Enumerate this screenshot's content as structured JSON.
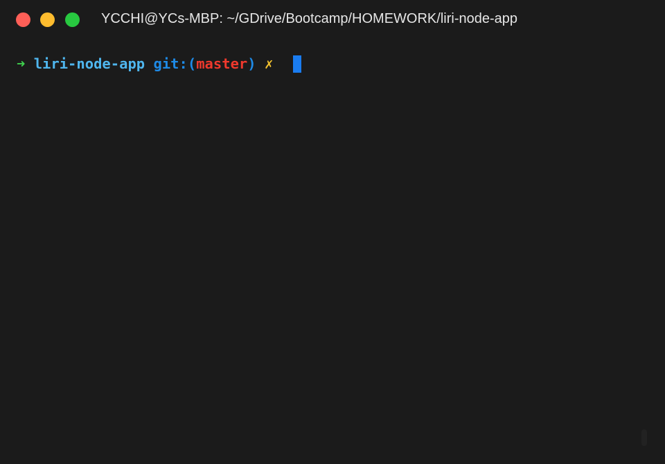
{
  "window": {
    "title": "YCCHI@YCs-MBP: ~/GDrive/Bootcamp/HOMEWORK/liri-node-app"
  },
  "prompt": {
    "arrow": "➜",
    "directory": "liri-node-app",
    "git_prefix": "git:(",
    "branch": "master",
    "git_suffix": ")",
    "dirty_marker": "✗"
  },
  "colors": {
    "arrow": "#3fd04d",
    "directory": "#4fb6ee",
    "git": "#1e8ae6",
    "branch": "#f0392d",
    "dirty": "#f2c12e",
    "cursor": "#1a7cf0"
  }
}
